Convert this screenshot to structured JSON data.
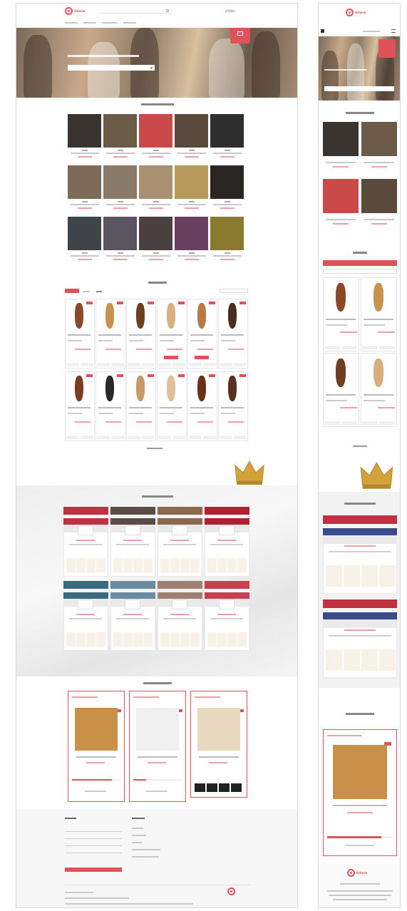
{
  "desktop": {
    "logo_text": "Gitarm",
    "header_search_placeholder": "",
    "header_link": "고객센터",
    "nav": [
      "",
      "",
      "",
      ""
    ],
    "hero": {
      "title": "",
      "search_placeholder": "",
      "badge_label": ""
    },
    "sections": {
      "section1_title": "",
      "section2_title": "",
      "section2_tabs": [
        "",
        "",
        ""
      ],
      "section2_more": "",
      "section3_title": "",
      "section4_title": ""
    },
    "footer": {
      "col1_title": "",
      "col2_title": "",
      "submit_label": ""
    }
  },
  "mobile": {
    "logo_text": "Gitarm",
    "header_link": "",
    "section1_title": "",
    "section2_title": "",
    "section2_more": "",
    "section3_title": "",
    "section4_title": ""
  },
  "colors": {
    "accent": "#e0525a",
    "crown": "#d4a23a"
  },
  "icons": [
    "search-icon",
    "menu-icon",
    "cart-icon",
    "crown-icon",
    "heart-icon"
  ]
}
